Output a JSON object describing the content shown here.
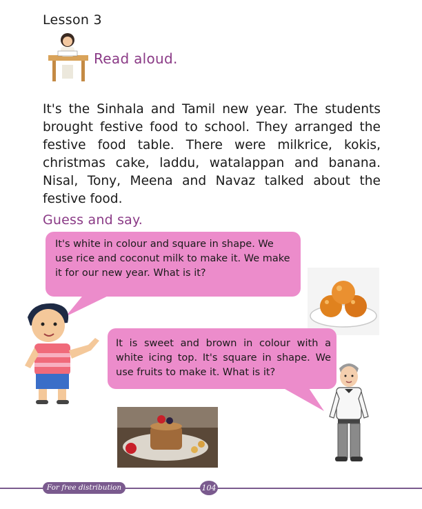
{
  "lesson": {
    "title": "Lesson 3"
  },
  "read_aloud": {
    "label": "Read aloud."
  },
  "story": {
    "text": "It's the Sinhala and Tamil new year. The students brought festive food to school. They arranged the festive food table. There were milkrice, kokis, christmas cake, laddu, watalappan and banana. Nisal, Tony, Meena and Navaz talked about the festive food."
  },
  "guess_say": {
    "label": "Guess and say."
  },
  "bubbles": [
    {
      "text": "It's white in colour and square in shape. We use rice and coconut milk to make it. We make it for our new year. What is it?"
    },
    {
      "text": "It is sweet and brown in colour with a white icing top. It's square in shape. We use fruits to make it. What is it?"
    }
  ],
  "footer": {
    "distribution": "For free distribution",
    "page_number": "104"
  },
  "colors": {
    "heading_purple": "#8a3a86",
    "bubble_pink": "#ec8ccb",
    "footer_purple": "#7a5a8e"
  }
}
